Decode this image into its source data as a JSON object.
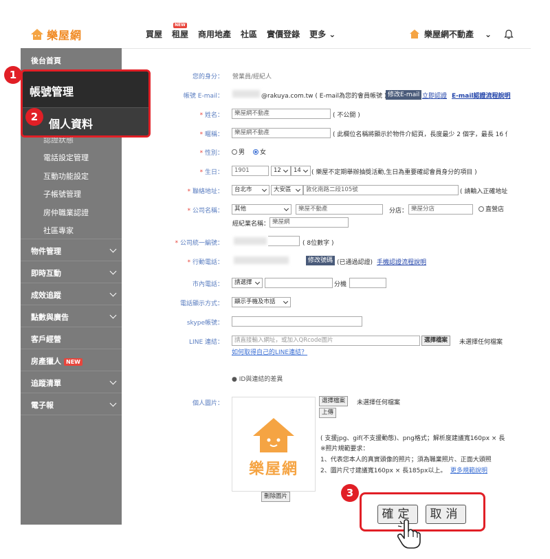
{
  "nav": {
    "logo_text": "樂屋網",
    "links": [
      "買屋",
      "租屋",
      "商用地產",
      "社區",
      "實價登錄",
      "更多"
    ],
    "new_badge": "NEW",
    "user_name": "樂屋網不動產"
  },
  "sidebar": {
    "top_item": "後台首頁",
    "account_mgmt": "帳號管理",
    "personal_info": "個人資料",
    "hidden_item": "認證狀態",
    "sub_items": [
      "電話設定管理",
      "互動功能設定",
      "子帳號管理",
      "房仲職業認證",
      "社區專家"
    ],
    "sections": [
      "物件管理",
      "即時互動",
      "成效追蹤",
      "點數與廣告",
      "客戶經營",
      "房產獵人",
      "追蹤清單",
      "電子報"
    ],
    "new_tag": "NEW"
  },
  "badges": {
    "one": "1",
    "two": "2",
    "three": "3"
  },
  "form": {
    "identity_label": "您的身分：",
    "identity_value": "營業員/經紀人",
    "email_label": "帳號 E-mail：",
    "email_value": "@rakuya.com.tw ( E-mail為您的會員帳號 )",
    "email_edit_btn": "修改E-mail",
    "email_verify_link": "立即認證",
    "email_help_link": "E-mail認證流程說明",
    "name_label": "姓名：",
    "name_value": "樂屋網不動產",
    "name_note": "( 不公開 )",
    "nick_label": "暱稱：",
    "nick_value": "樂屋網不動產",
    "nick_note": "( 此欄位名稱將顯示於物件介紹頁，長度最少 2 個字，最長 16 個",
    "gender_label": "性別：",
    "gender_male": "男",
    "gender_female": "女",
    "birth_label": "生日：",
    "birth_year": "1901",
    "birth_month": "12",
    "birth_day": "14",
    "birth_note": "( 樂屋不定期舉辦抽獎活動,生日為重要確認會員身分的項目 )",
    "addr_label": "聯絡地址：",
    "addr_city": "台北市",
    "addr_district": "大安區",
    "addr_street": "敦化南路二段105號",
    "addr_note": "( 請輸入正確地址",
    "company_label": "公司名稱：",
    "company_type": "其他",
    "company_name": "樂屋不動產",
    "branch_label": "分店：",
    "branch_value": "樂屋分店",
    "direct_label": "直營店",
    "brand_label": "經紀業名稱：",
    "brand_value": "樂屋網",
    "taxid_label": "公司統一編號：",
    "taxid_note": "( 8位數字 )",
    "mobile_label": "行動電話：",
    "mobile_edit_btn": "修改號碼",
    "mobile_status": "(已通過認證)",
    "mobile_help_link": "手機認證流程說明",
    "phone_label": "市內電話：",
    "phone_select": "請選擇",
    "phone_ext": "分機",
    "display_label": "電話顯示方式：",
    "display_value": "顯示手機及市話",
    "skype_label": "skype帳號：",
    "line_label": "LINE 連結：",
    "line_placeholder": "請直接輸入網址，或加入QRcode圖片",
    "line_file_btn": "選擇檔案",
    "line_file_status": "未選擇任何檔案",
    "line_help_link": "如何取得自己的LINE連結？",
    "id_diff": "ID與連結的差異",
    "photo_label": "個人圖片：",
    "photo_file_btn": "選擇檔案",
    "photo_file_status": "未選擇任何檔案",
    "upload_btn": "上傳",
    "photo_logo_text": "樂屋網",
    "photo_note1": "( 支援jpg、gif(不支援動態)、png格式；解析度建議寬160px × 長",
    "photo_note2": "※照片規範要求：",
    "photo_note3": "1、代表您本人的真實頭像的照片；須為職業照片、正面大頭照",
    "photo_note4": "2、圖片尺寸建議寬160px × 長185px以上。",
    "photo_more_link": "更多規範說明",
    "delete_photo_btn": "刪除圖片",
    "confirm_btn": "確定",
    "cancel_btn": "取消"
  },
  "colors": {
    "brand_orange": "#f08a24",
    "callout_red": "#e11f26",
    "sidebar_gray": "#7b7b7b"
  }
}
